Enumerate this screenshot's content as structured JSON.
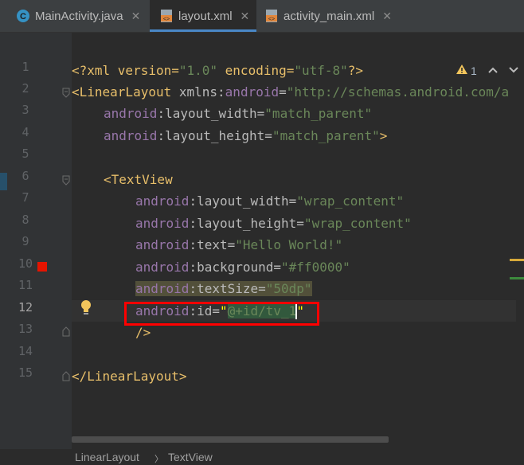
{
  "tabs": [
    {
      "label": "MainActivity.java",
      "icon": "java-class-icon",
      "active": false
    },
    {
      "label": "layout.xml",
      "icon": "xml-file-icon",
      "active": true
    },
    {
      "label": "activity_main.xml",
      "icon": "xml-file-icon",
      "active": false
    }
  ],
  "close_glyph": "✕",
  "inspections": {
    "warning_count": "1"
  },
  "line_numbers": [
    "1",
    "2",
    "3",
    "4",
    "5",
    "6",
    "7",
    "8",
    "9",
    "10",
    "11",
    "12",
    "13",
    "14",
    "15"
  ],
  "current_line": "12",
  "code": {
    "l1": {
      "a": "<?xml version=",
      "b": "\"1.0\"",
      "c": " encoding=",
      "d": "\"utf-8\"",
      "e": "?>"
    },
    "l2": {
      "a": "<LinearLayout",
      "b": " xmlns:",
      "c": "android",
      "d": "=",
      "e": "\"http://schemas.android.com/a"
    },
    "l3": {
      "a": "android",
      "b": ":layout_width=",
      "c": "\"match_parent\""
    },
    "l4": {
      "a": "android",
      "b": ":layout_height=",
      "c": "\"match_parent\"",
      "d": ">"
    },
    "l6": {
      "a": "<TextView"
    },
    "l7": {
      "a": "android",
      "b": ":layout_width=",
      "c": "\"wrap_content\""
    },
    "l8": {
      "a": "android",
      "b": ":layout_height=",
      "c": "\"wrap_content\""
    },
    "l9": {
      "a": "android",
      "b": ":text=",
      "c": "\"Hello World!\""
    },
    "l10": {
      "a": "android",
      "b": ":background=",
      "c": "\"#ff0000\""
    },
    "l11": {
      "a": "android",
      "b": ":textSize=",
      "c": "\"50dp\""
    },
    "l12": {
      "a": "android",
      "b": ":id=",
      "c": "\"",
      "d": "@+id/tv_1",
      "e": "\""
    },
    "l13": {
      "a": "/>"
    },
    "l15": {
      "a": "</LinearLayout>"
    }
  },
  "breadcrumb": {
    "item1": "LinearLayout",
    "sep": "〉",
    "item2": "TextView"
  },
  "colors": {
    "accent": "#4a88c7",
    "breakpoint": "#e51400",
    "highlight_box": "#ff0000"
  }
}
